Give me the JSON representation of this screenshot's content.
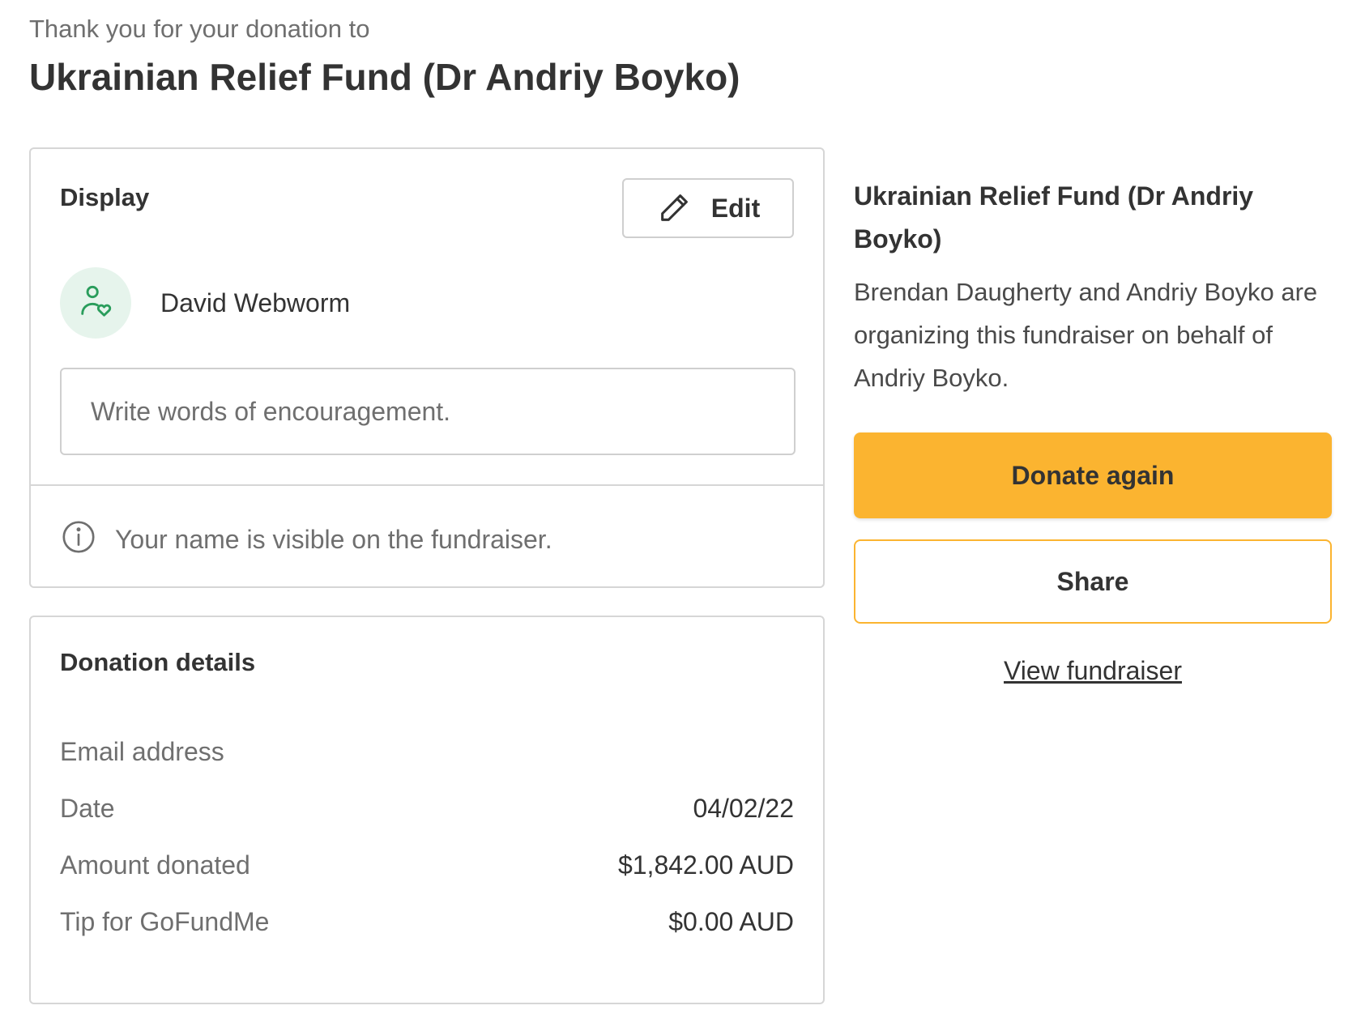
{
  "header": {
    "pretitle": "Thank you for your donation to",
    "title": "Ukrainian Relief Fund (Dr Andriy Boyko)"
  },
  "display_card": {
    "heading": "Display",
    "edit_label": "Edit",
    "edit_icon": "pencil-icon",
    "avatar_icon": "person-heart-icon",
    "donor_name": "David Webworm",
    "encouragement_placeholder": "Write words of encouragement.",
    "encouragement_value": "",
    "info_icon": "info-icon",
    "visibility_note": "Your name is visible on the fundraiser."
  },
  "details_card": {
    "heading": "Donation details",
    "rows": [
      {
        "label": "Email address",
        "value": ""
      },
      {
        "label": "Date",
        "value": "04/02/22"
      },
      {
        "label": "Amount donated",
        "value": "$1,842.00 AUD"
      },
      {
        "label": "Tip for GoFundMe",
        "value": "$0.00 AUD"
      }
    ]
  },
  "sidebar": {
    "title": "Ukrainian Relief Fund (Dr Andriy Boyko)",
    "description": "Brendan Daugherty and Andriy Boyko are organizing this fundraiser on behalf of Andriy Boyko.",
    "donate_label": "Donate again",
    "share_label": "Share",
    "view_link": "View fundraiser"
  },
  "colors": {
    "accent": "#fbb430",
    "avatar_bg": "#e6f4ec",
    "avatar_icon": "#2a9d5c",
    "border": "#d6d6d6"
  }
}
